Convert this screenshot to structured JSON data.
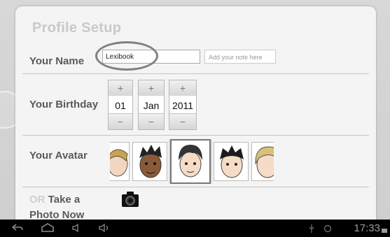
{
  "screen": {
    "title": "Profile Setup",
    "name_row": {
      "label": "Your Name",
      "name_value": "Lexibook",
      "note_placeholder": "Add your note here"
    },
    "birthday_row": {
      "label": "Your Birthday",
      "day": "01",
      "month": "Jan",
      "year": "2011",
      "plus_symbol": "+",
      "minus_symbol": "−"
    },
    "avatar_row": {
      "label": "Your Avatar",
      "avatars": [
        "avatar-1",
        "avatar-2",
        "avatar-3",
        "avatar-4",
        "avatar-5"
      ],
      "selected_index": 2
    },
    "photo_row": {
      "or_text": "OR",
      "label_line1": "Take a",
      "label_line2": "Photo Now"
    }
  },
  "system_bar": {
    "clock": "17:33",
    "icons": [
      "back-icon",
      "home-icon",
      "volume-down-icon",
      "volume-up-icon",
      "usb-icon",
      "sync-icon",
      "battery-icon"
    ]
  },
  "colors": {
    "highlight_ring": "#808080",
    "label_text": "#5a5a5a",
    "title_text": "#c9c9c9",
    "navbar": "#000000"
  }
}
